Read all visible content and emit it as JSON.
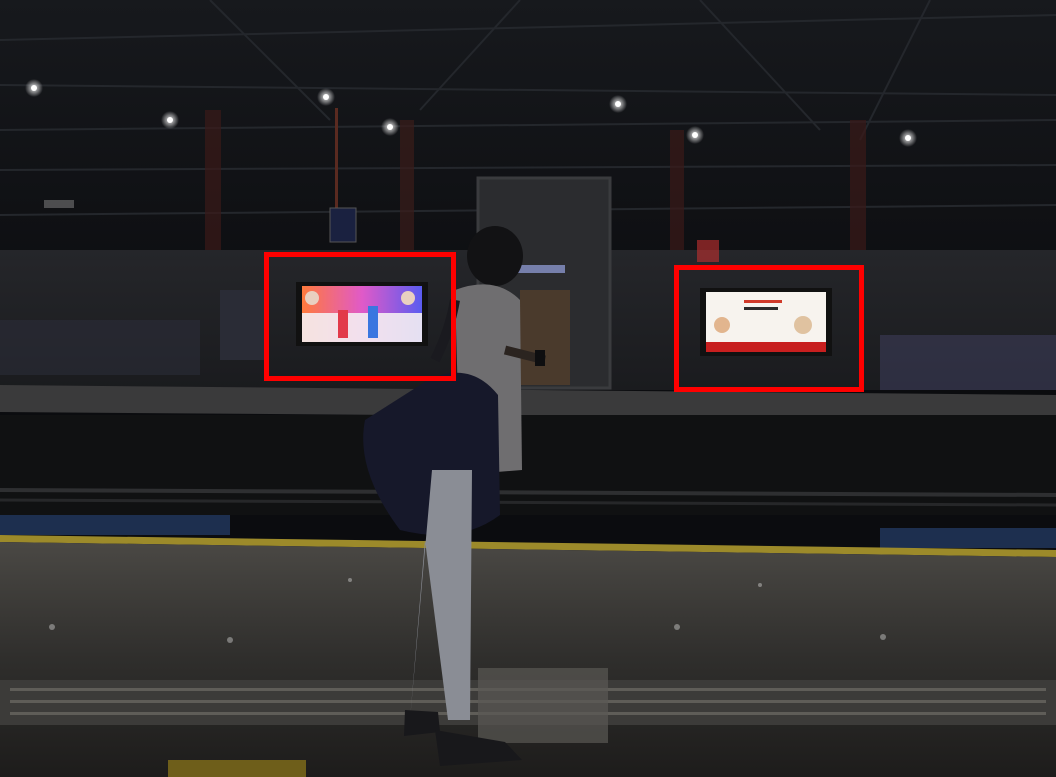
{
  "image": {
    "subject": "metro-station-platform",
    "highlight_color": "#ff0000",
    "highlighted_regions": [
      {
        "name": "advertisement-display-left"
      },
      {
        "name": "advertisement-display-right"
      }
    ]
  }
}
